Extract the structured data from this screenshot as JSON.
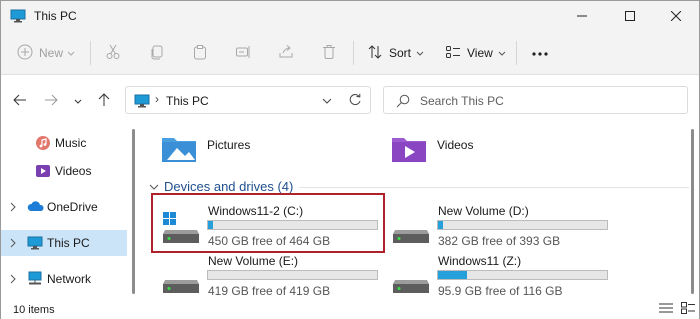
{
  "window": {
    "title": "This PC"
  },
  "commandbar": {
    "new_label": "New",
    "sort_label": "Sort",
    "view_label": "View"
  },
  "address": {
    "location": "This PC"
  },
  "search": {
    "placeholder": "Search This PC"
  },
  "sidebar": {
    "items": [
      {
        "label": "Music",
        "icon": "music-icon"
      },
      {
        "label": "Videos",
        "icon": "videos-icon"
      },
      {
        "label": "OneDrive",
        "icon": "cloud-icon"
      },
      {
        "label": "This PC",
        "icon": "pc-icon",
        "selected": true
      },
      {
        "label": "Network",
        "icon": "network-icon"
      }
    ]
  },
  "folders": [
    {
      "label": "Pictures",
      "icon": "pictures-folder-icon"
    },
    {
      "label": "Videos",
      "icon": "videos-folder-icon"
    }
  ],
  "group": {
    "header": "Devices and drives (4)"
  },
  "drives": [
    {
      "name": "Windows11-2 (C:)",
      "free": "450 GB free of 464 GB",
      "used_fraction": 0.03,
      "icon": "windows-drive-icon"
    },
    {
      "name": "New Volume (D:)",
      "free": "382 GB free of 393 GB",
      "used_fraction": 0.03,
      "icon": "drive-icon"
    },
    {
      "name": "New Volume (E:)",
      "free": "419 GB free of 419 GB",
      "used_fraction": 0.0,
      "icon": "drive-icon"
    },
    {
      "name": "Windows11 (Z:)",
      "free": "95.9 GB free of 116 GB",
      "used_fraction": 0.17,
      "icon": "drive-icon"
    }
  ],
  "status": {
    "item_count": "10 items"
  },
  "colors": {
    "accent": "#26a0da",
    "highlight": "#b0222b",
    "selected": "#cce4f7",
    "group_header": "#1f4f8e"
  }
}
